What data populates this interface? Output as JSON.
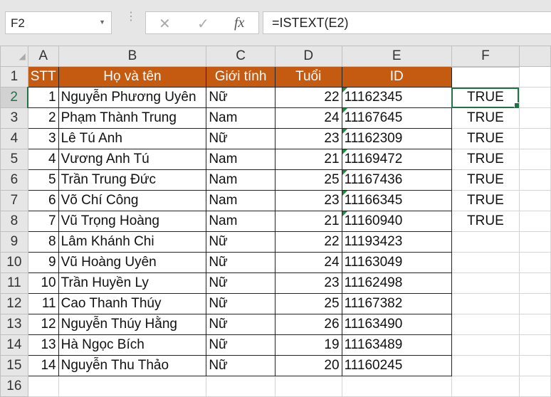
{
  "name_box": "F2",
  "formula": "=ISTEXT(E2)",
  "fx_label": "fx",
  "cancel_icon": "✕",
  "enter_icon": "✓",
  "columns": [
    "A",
    "B",
    "C",
    "D",
    "E",
    "F"
  ],
  "headers": [
    "STT",
    "Họ và tên",
    "Giới tính",
    "Tuổi",
    "ID"
  ],
  "header_color": "#c55a11",
  "rows": [
    [
      "1",
      "Nguyễn Phương Uyên",
      "Nữ",
      "22",
      "11162345",
      "TRUE"
    ],
    [
      "2",
      "Phạm Thành Trung",
      "Nam",
      "24",
      "11167645",
      "TRUE"
    ],
    [
      "3",
      "Lê Tú Anh",
      "Nữ",
      "23",
      "11162309",
      "TRUE"
    ],
    [
      "4",
      "Vương Anh Tú",
      "Nam",
      "21",
      "11169472",
      "TRUE"
    ],
    [
      "5",
      "Trần Trung Đức",
      "Nam",
      "25",
      "11167436",
      "TRUE"
    ],
    [
      "6",
      "Võ Chí Công",
      "Nam",
      "23",
      "11166345",
      "TRUE"
    ],
    [
      "7",
      "Vũ Trọng Hoàng",
      "Nam",
      "21",
      "11160940",
      "TRUE"
    ],
    [
      "8",
      "Lâm Khánh Chi",
      "Nữ",
      "22",
      "11193423",
      ""
    ],
    [
      "9",
      "Vũ Hoàng Uyên",
      "Nữ",
      "24",
      "11163049",
      ""
    ],
    [
      "10",
      "Trần Huyền Ly",
      "Nữ",
      "23",
      "11162498",
      ""
    ],
    [
      "11",
      "Cao Thanh Thúy",
      "Nữ",
      "25",
      "11167382",
      ""
    ],
    [
      "12",
      "Nguyễn Thúy Hằng",
      "Nữ",
      "26",
      "11163490",
      ""
    ],
    [
      "13",
      "Hà Ngọc Bích",
      "Nữ",
      "19",
      "11163489",
      ""
    ],
    [
      "14",
      "Nguyễn Thu Thảo",
      "Nữ",
      "20",
      "11160245",
      ""
    ]
  ]
}
